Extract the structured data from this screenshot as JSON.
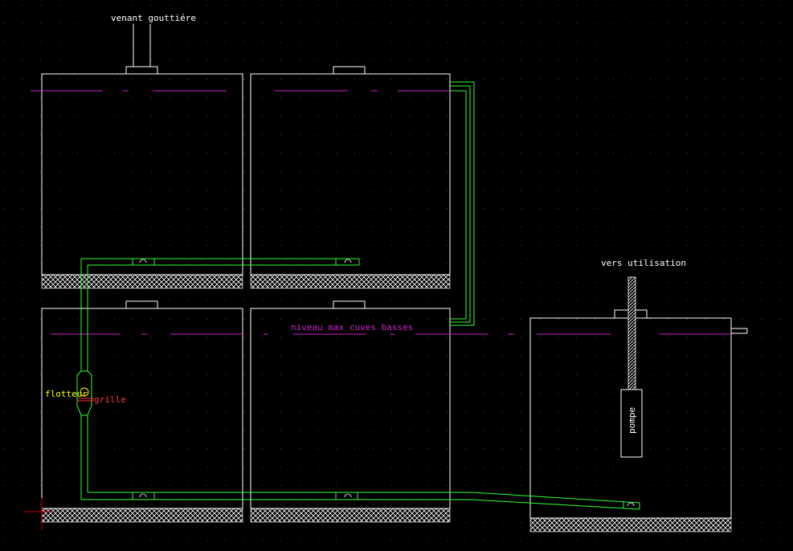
{
  "colors": {
    "background": "#000000",
    "grid": "#4a4a4a",
    "tank": "#ffffff",
    "pipe": "#33ff33",
    "level": "#cc22cc",
    "float_label": "#ffff00",
    "grid_label": "#ff3333",
    "ground_hatch": "#ffffff",
    "axis_origin": "#cc0000",
    "white_text": "#ffffff"
  },
  "labels": {
    "inlet": "venant gouttiére",
    "outlet": "vers utilisation",
    "max_level": "niveau  max cuves basses",
    "float": "flotteur",
    "grid": "grille",
    "pump": "pompe"
  },
  "icons": {
    "float_valve": "float-valve-icon",
    "pipe_fitting": "pipe-fitting-icon"
  }
}
